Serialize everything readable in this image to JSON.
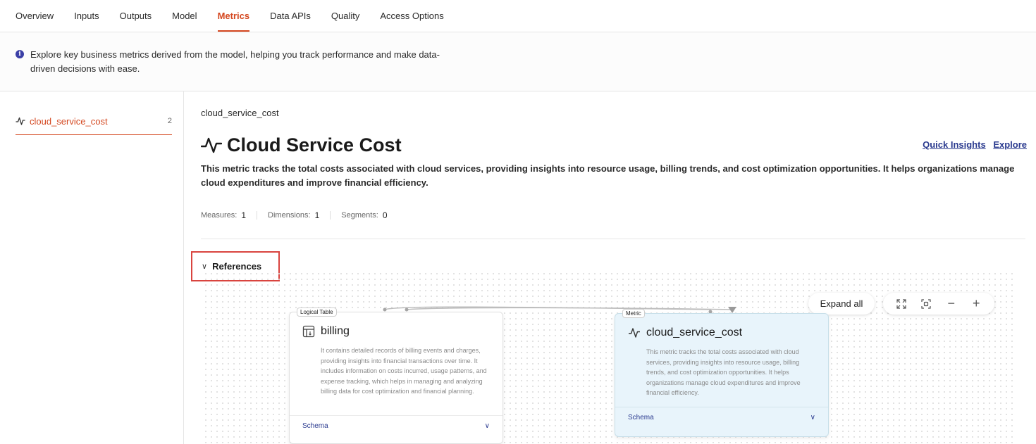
{
  "tabs": [
    {
      "label": "Overview",
      "active": false
    },
    {
      "label": "Inputs",
      "active": false
    },
    {
      "label": "Outputs",
      "active": false
    },
    {
      "label": "Model",
      "active": false
    },
    {
      "label": "Metrics",
      "active": true
    },
    {
      "label": "Data APIs",
      "active": false
    },
    {
      "label": "Quality",
      "active": false
    },
    {
      "label": "Access Options",
      "active": false
    }
  ],
  "info": {
    "icon": "info-icon",
    "text": "Explore key business metrics derived from the model, helping you track performance and make data-driven decisions with ease."
  },
  "sidebar": {
    "items": [
      {
        "icon": "pulse-icon",
        "label": "cloud_service_cost",
        "count": "2"
      }
    ]
  },
  "main": {
    "breadcrumb": "cloud_service_cost",
    "title": "Cloud Service Cost",
    "title_icon": "pulse-icon",
    "links": {
      "quick_insights": "Quick Insights",
      "explore": "Explore"
    },
    "description": "This metric tracks the total costs associated with cloud services, providing insights into resource usage, billing trends, and cost optimization opportunities. It helps organizations manage cloud expenditures and improve financial efficiency.",
    "stats": {
      "measures_label": "Measures:",
      "measures_value": "1",
      "dimensions_label": "Dimensions:",
      "dimensions_value": "1",
      "segments_label": "Segments:",
      "segments_value": "0"
    },
    "references_label": "References"
  },
  "graph": {
    "controls": {
      "expand_all": "Expand all",
      "icons": [
        "fullscreen-icon",
        "fit-view-icon",
        "zoom-out-icon",
        "zoom-in-icon"
      ]
    },
    "nodes": {
      "billing": {
        "tag": "Logical Table",
        "icon": "table-icon",
        "title": "billing",
        "description": "It contains detailed records of billing events and charges, providing insights into financial transactions over time. It includes information on costs incurred, usage patterns, and expense tracking, which helps in managing and analyzing billing data for cost optimization and financial planning.",
        "schema_label": "Schema"
      },
      "metric": {
        "tag": "Metric",
        "icon": "pulse-icon",
        "title": "cloud_service_cost",
        "description": "This metric tracks the total costs associated with cloud services, providing insights into resource usage, billing trends, and cost optimization opportunities. It helps organizations manage cloud expenditures and improve financial efficiency.",
        "schema_label": "Schema"
      }
    }
  },
  "colors": {
    "accent": "#d4471f",
    "link": "#2a3a8f",
    "highlight_box": "#d9443f",
    "metric_node_bg": "#e8f4fb"
  }
}
